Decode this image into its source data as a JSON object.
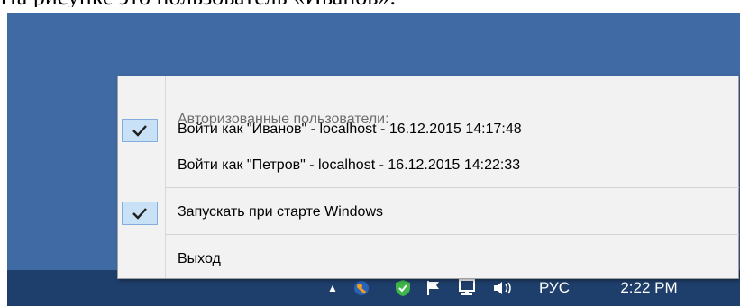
{
  "document": {
    "caption": "На рисунке это пользователь «Иванов»."
  },
  "tray_menu": {
    "header": "Авторизованные пользователи:",
    "items": [
      {
        "label": "Войти как \"Иванов\" - localhost - 16.12.2015 14:17:48",
        "checked": true
      },
      {
        "label": "Войти как \"Петров\" - localhost - 16.12.2015 14:22:33",
        "checked": false
      },
      {
        "label": "Запускать при старте Windows",
        "checked": true
      },
      {
        "label": "Выход",
        "checked": false
      }
    ]
  },
  "taskbar": {
    "language": "РУС",
    "clock": "2:22 PM"
  },
  "colors": {
    "desktop": "#3f6aa3",
    "taskbar": "#1e3f6b",
    "menu_background": "#f2f2f2",
    "check_highlight": "#c9e1f6"
  }
}
